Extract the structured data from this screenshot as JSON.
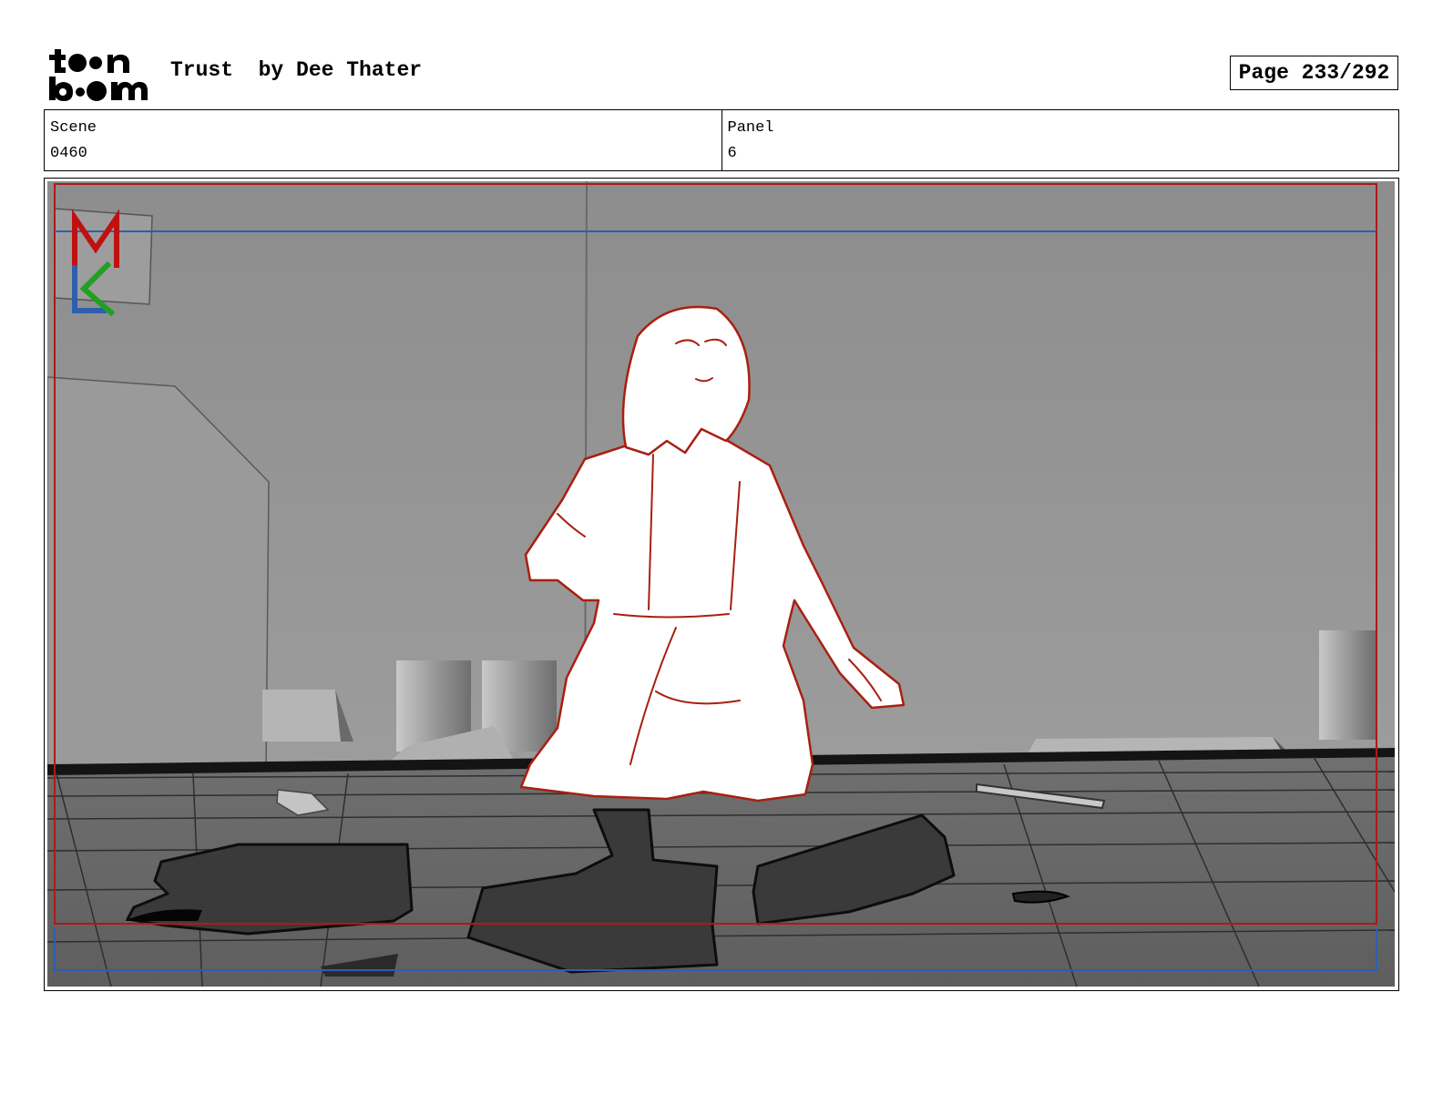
{
  "header": {
    "logo_text": [
      "toon",
      "boom"
    ],
    "title": "Trust  by Dee Thater",
    "page": "Page 233/292"
  },
  "info": {
    "scene_label": "Scene",
    "scene_value": "0460",
    "panel_label": "Panel",
    "panel_value": "6"
  },
  "panel_image": {
    "corner_mark": "MK",
    "colors": {
      "safe_frame": "#b01818",
      "camera_frame": "#2c5fb0",
      "sketch_line": "#a82010"
    }
  }
}
